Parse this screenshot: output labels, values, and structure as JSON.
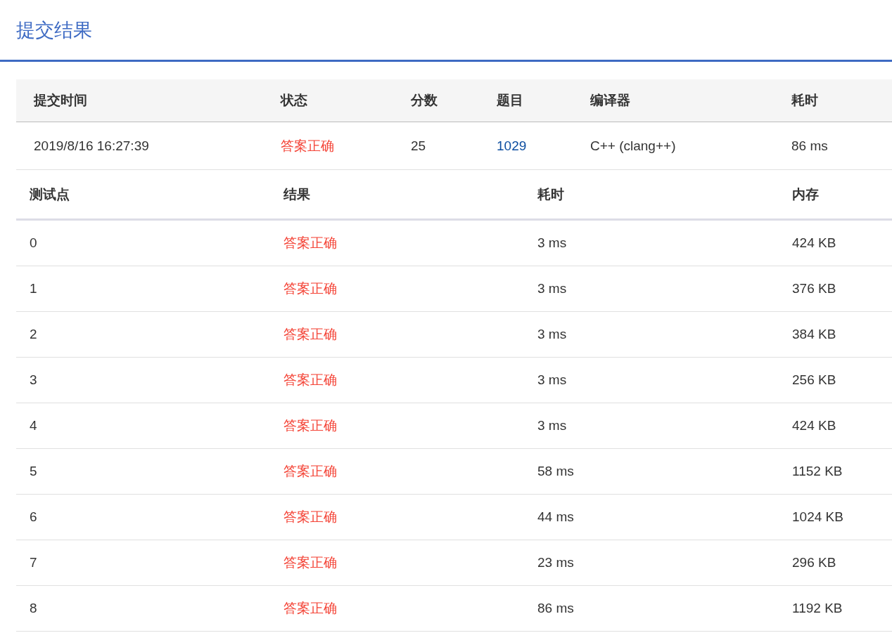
{
  "page_title": "提交结果",
  "submission": {
    "columns": [
      "提交时间",
      "状态",
      "分数",
      "题目",
      "编译器",
      "耗时"
    ],
    "row": {
      "time": "2019/8/16 16:27:39",
      "status": "答案正确",
      "score": "25",
      "problem": "1029",
      "compiler": "C++ (clang++)",
      "duration": "86 ms"
    }
  },
  "test_cases": {
    "columns": [
      "测试点",
      "结果",
      "耗时",
      "内存"
    ],
    "rows": [
      {
        "case": "0",
        "result": "答案正确",
        "time": "3 ms",
        "memory": "424 KB"
      },
      {
        "case": "1",
        "result": "答案正确",
        "time": "3 ms",
        "memory": "376 KB"
      },
      {
        "case": "2",
        "result": "答案正确",
        "time": "3 ms",
        "memory": "384 KB"
      },
      {
        "case": "3",
        "result": "答案正确",
        "time": "3 ms",
        "memory": "256 KB"
      },
      {
        "case": "4",
        "result": "答案正确",
        "time": "3 ms",
        "memory": "424 KB"
      },
      {
        "case": "5",
        "result": "答案正确",
        "time": "58 ms",
        "memory": "1152 KB"
      },
      {
        "case": "6",
        "result": "答案正确",
        "time": "44 ms",
        "memory": "1024 KB"
      },
      {
        "case": "7",
        "result": "答案正确",
        "time": "23 ms",
        "memory": "296 KB"
      },
      {
        "case": "8",
        "result": "答案正确",
        "time": "86 ms",
        "memory": "1192 KB"
      }
    ]
  }
}
